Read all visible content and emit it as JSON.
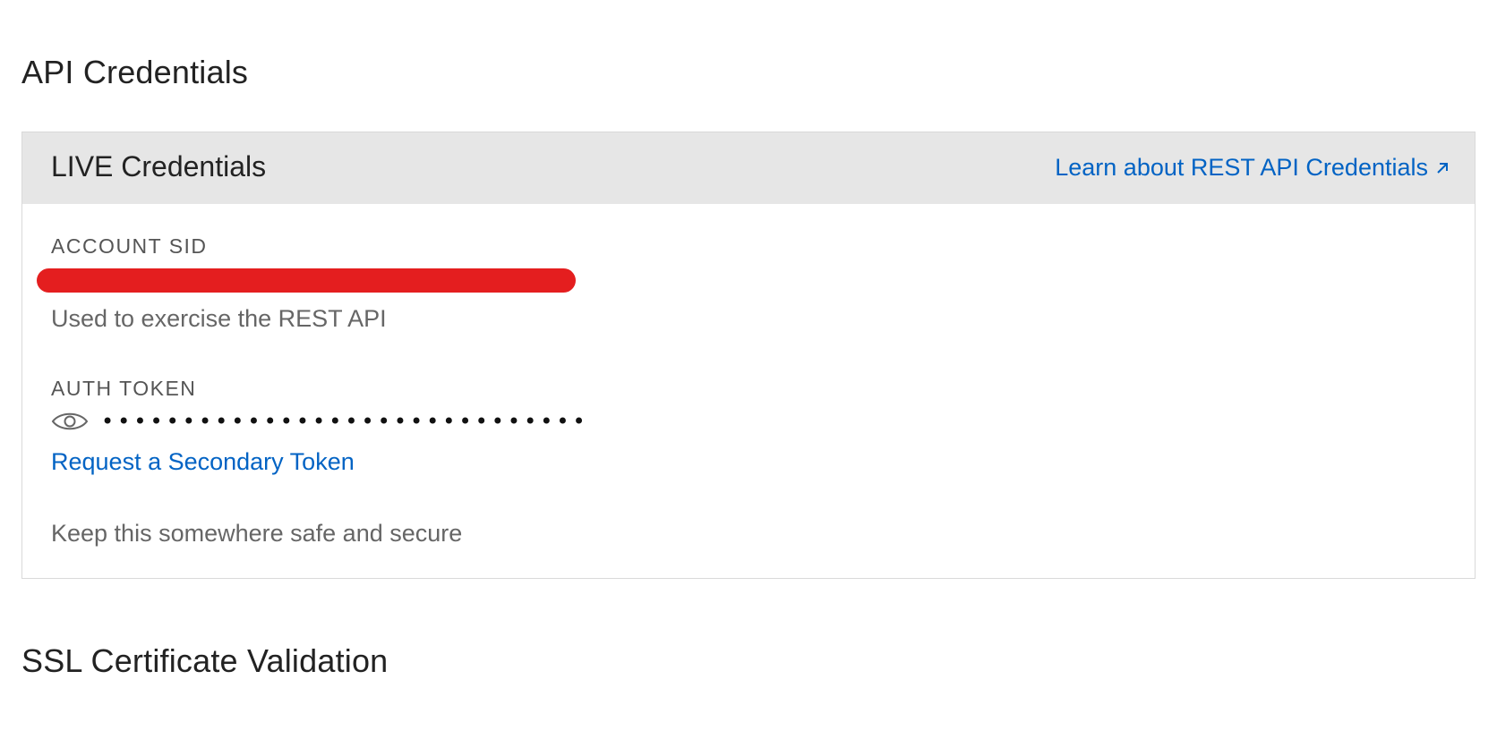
{
  "sections": {
    "api_title": "API Credentials",
    "ssl_title": "SSL Certificate Validation"
  },
  "card": {
    "header_title": "LIVE Credentials",
    "learn_link": "Learn about REST API Credentials"
  },
  "account_sid": {
    "label": "ACCOUNT SID",
    "help": "Used to exercise the REST API"
  },
  "auth_token": {
    "label": "AUTH TOKEN",
    "masked_value": "••••••••••••••••••••••••••••••••",
    "secondary_link": "Request a Secondary Token",
    "help": "Keep this somewhere safe and secure"
  },
  "icons": {
    "reveal": "eye-icon",
    "external": "external-link-icon"
  },
  "colors": {
    "link": "#0263c4",
    "redaction": "#e41e1f",
    "header_bg": "#e6e6e6"
  }
}
